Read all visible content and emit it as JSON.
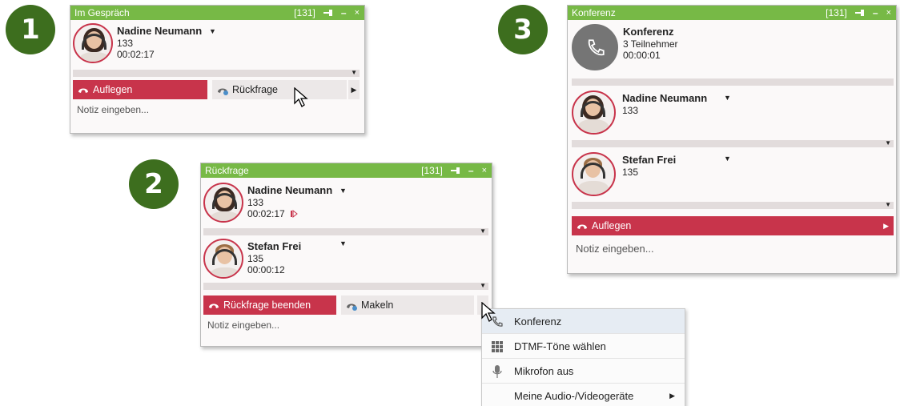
{
  "steps": [
    "1",
    "2",
    "3"
  ],
  "windows": {
    "w1": {
      "title": "Im Gespräch",
      "line": "[131]",
      "contacts": [
        {
          "name": "Nadine Neumann",
          "number": "133",
          "duration": "00:02:17"
        }
      ],
      "buttons": {
        "primary": "Auflegen",
        "secondary": "Rückfrage"
      },
      "note_placeholder": "Notiz eingeben..."
    },
    "w2": {
      "title": "Rückfrage",
      "line": "[131]",
      "contacts": [
        {
          "name": "Nadine Neumann",
          "number": "133",
          "duration": "00:02:17"
        },
        {
          "name": "Stefan Frei",
          "number": "135",
          "duration": "00:00:12"
        }
      ],
      "buttons": {
        "primary": "Rückfrage beenden",
        "secondary": "Makeln"
      },
      "note_placeholder": "Notiz eingeben..."
    },
    "w3": {
      "title": "Konferenz",
      "line": "[131]",
      "conference": {
        "name": "Konferenz",
        "participants": "3 Teilnehmer",
        "duration": "00:00:01"
      },
      "contacts": [
        {
          "name": "Nadine Neumann",
          "number": "133"
        },
        {
          "name": "Stefan Frei",
          "number": "135"
        }
      ],
      "buttons": {
        "primary": "Auflegen"
      },
      "note_placeholder": "Notiz eingeben..."
    }
  },
  "context_menu": {
    "items": [
      "Konferenz",
      "DTMF-Töne wählen",
      "Mikrofon aus",
      "Meine Audio-/Videogeräte"
    ]
  },
  "colors": {
    "titlebar": "#77b946",
    "accent_red": "#c8344b",
    "step_badge": "#3d6e1e"
  }
}
